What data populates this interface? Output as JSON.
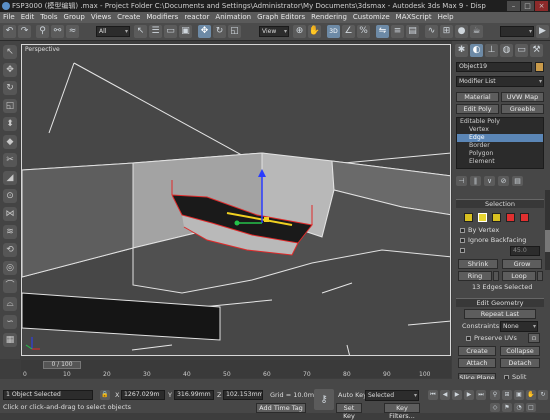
{
  "titlebar": {
    "text": "FSP3000 (模型编辑)  .max   - Project Folder  C:\\Documents and Settings\\Administrator\\My Documents\\3dsmax   - Autodesk 3ds Max 9      - Disp"
  },
  "menu": [
    "File",
    "Edit",
    "Tools",
    "Group",
    "Views",
    "Create",
    "Modifiers",
    "reactor",
    "Animation",
    "Graph Editors",
    "Rendering",
    "Customize",
    "MAXScript",
    "Help"
  ],
  "toolbar": {
    "filter_value": "All",
    "view_value": "View",
    "snap_label": "3D"
  },
  "viewport": {
    "label": "Perspective"
  },
  "panel": {
    "object_name": "Object19",
    "modifier_list": "Modifier List",
    "btn_material": "Material",
    "btn_uvw": "UVW Map",
    "btn_editpoly": "Edit Poly",
    "btn_greeble": "Greeble",
    "stack": [
      "Editable Poly",
      "Vertex",
      "Edge",
      "Border",
      "Polygon",
      "Element"
    ],
    "selection_title": "Selection",
    "by_vertex": "By Vertex",
    "ignore_backfacing": "Ignore Backfacing",
    "by_angle_value": "45.0",
    "shrink": "Shrink",
    "grow": "Grow",
    "ring": "Ring",
    "loop": "Loop",
    "edges_selected": "13 Edges Selected",
    "edit_geometry_title": "Edit Geometry",
    "repeat_last": "Repeat Last",
    "constraints_label": "Constraints:",
    "constraints_value": "None",
    "preserve_uvs": "Preserve UVs",
    "create": "Create",
    "collapse": "Collapse",
    "attach": "Attach",
    "detach": "Detach",
    "slice_plane": "Slice Plane",
    "split": "Split"
  },
  "timeline": {
    "frame": "0 / 100",
    "ticks": [
      "0",
      "10",
      "20",
      "30",
      "40",
      "50",
      "60",
      "70",
      "80",
      "90",
      "100"
    ]
  },
  "status": {
    "selected": "1 Object Selected",
    "prompt": "Click or click-and-drag to select objects",
    "x": "1267.029m",
    "y": "316.99mm",
    "z": "102.153mm",
    "grid": "Grid = 10.0mm",
    "add_time_tag": "Add Time Tag",
    "auto_key": "Auto Key",
    "selected_dd": "Selected",
    "set_key": "Set Key",
    "key_filters": "Key Filters...",
    "x_label": "X",
    "y_label": "Y",
    "z_label": "Z"
  }
}
